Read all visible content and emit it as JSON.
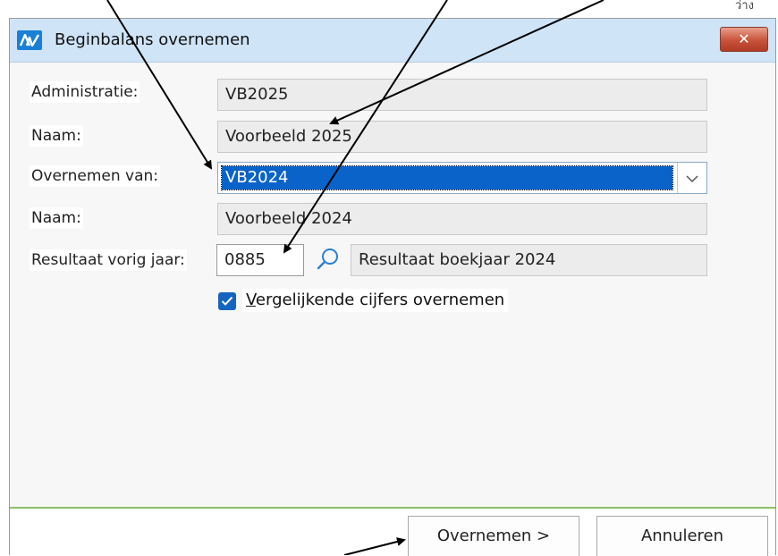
{
  "corner_text": "ว่าง",
  "window": {
    "title": "Beginbalans overnemen",
    "close_label": "✕"
  },
  "form": {
    "administratie_label": "Administratie:",
    "administratie_value": "VB2025",
    "naam1_label": "Naam:",
    "naam1_value": "Voorbeeld 2025",
    "overnemen_label": "Overnemen van:",
    "overnemen_value": "VB2024",
    "naam2_label": "Naam:",
    "naam2_value": "Voorbeeld 2024",
    "resultaat_label": "Resultaat vorig jaar:",
    "resultaat_code": "0885",
    "resultaat_desc": "Resultaat boekjaar 2024",
    "checkbox_checked": true,
    "checkbox_label_first": "V",
    "checkbox_label_rest": "ergelijkende cijfers overnemen"
  },
  "buttons": {
    "overnemen": "Overnemen >",
    "annuleren": "Annuleren"
  },
  "colors": {
    "accent": "#0a63c9",
    "title_bar": "#cfe4f7",
    "footer_line": "#8dbf6a"
  }
}
